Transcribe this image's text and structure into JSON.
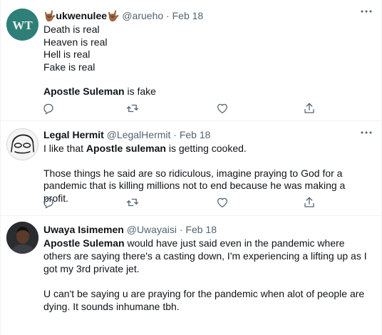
{
  "tweets": [
    {
      "author": {
        "name": "🤟🏾ukwenulee🤟🏾",
        "handle": "@arueho",
        "avatar_text": "WT",
        "avatar_color": "#2e7f78"
      },
      "date": "Feb 18",
      "lines": [
        "Death is real",
        "Heaven is real",
        "Hell is real",
        "Fake is real"
      ],
      "last_bold": "Apostle Suleman",
      "last_rest": " is fake"
    },
    {
      "author": {
        "name": "Legal Hermit",
        "handle": "@LegalHermit"
      },
      "date": "Feb 18",
      "p1_pre": "I like that ",
      "p1_bold": "Apostle suleman",
      "p1_post": " is getting cooked.",
      "p2": "Those things he said are so ridiculous, imagine praying to God for a pandemic that is killing millions not to end because he was making a profit."
    },
    {
      "author": {
        "name": "Uwaya Isimemen",
        "handle": "@Uwayaisi"
      },
      "date": "Feb 18",
      "p1_bold": "Apostle Suleman",
      "p1_post": " would have just said even in the pandemic where others are saying there's a casting down, I'm experiencing a lifting up as I got my 3rd private jet.",
      "p2": "U can't be saying u are praying for the pandemic when alot of people are dying. It sounds inhumane tbh."
    }
  ],
  "meta_separator": "·",
  "icons": [
    "reply-icon",
    "retweet-icon",
    "like-icon",
    "share-icon",
    "more-icon"
  ],
  "colors": {
    "text": "#0f1419",
    "secondary": "#536471",
    "divider": "#eff3f4"
  }
}
